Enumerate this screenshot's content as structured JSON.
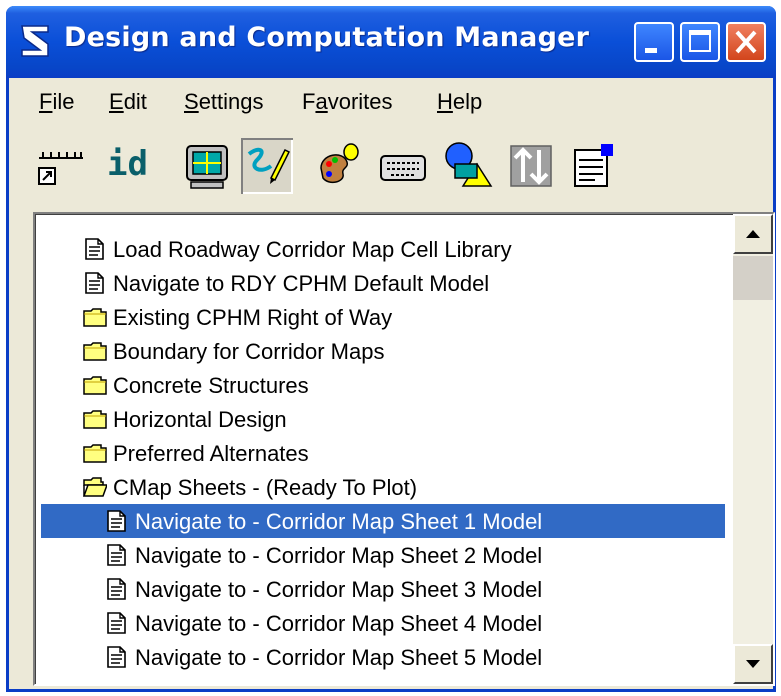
{
  "window": {
    "title": "Design and Computation Manager"
  },
  "menu": {
    "items": [
      {
        "pre": "",
        "u": "F",
        "post": "ile"
      },
      {
        "pre": "",
        "u": "E",
        "post": "dit"
      },
      {
        "pre": "",
        "u": "S",
        "post": "ettings"
      },
      {
        "pre": "F",
        "u": "a",
        "post": "vorites"
      },
      {
        "pre": "",
        "u": "H",
        "post": "elp"
      }
    ]
  },
  "toolbar": {
    "id_label": "id",
    "tools": [
      "scale-shortcut-icon",
      "id-icon",
      "display-icon",
      "draw-icon",
      "palette-icon",
      "keyboard-icon",
      "shapes-icon",
      "levels-icon",
      "properties-icon"
    ]
  },
  "list": {
    "items": [
      {
        "label": "Load Roadway Corridor Map Cell Library",
        "type": "doc"
      },
      {
        "label": "Navigate to RDY CPHM Default Model",
        "type": "doc"
      },
      {
        "label": "Existing CPHM Right of Way",
        "type": "folder"
      },
      {
        "label": "Boundary for Corridor Maps",
        "type": "folder"
      },
      {
        "label": "Concrete Structures",
        "type": "folder"
      },
      {
        "label": "Horizontal Design",
        "type": "folder"
      },
      {
        "label": "Preferred Alternates",
        "type": "folder"
      },
      {
        "label": "CMap Sheets - (Ready To Plot)",
        "type": "folder-open"
      },
      {
        "label": "Navigate to - Corridor Map Sheet 1 Model",
        "type": "doc",
        "selected": true
      },
      {
        "label": "Navigate to - Corridor Map Sheet 2 Model",
        "type": "doc"
      },
      {
        "label": "Navigate to - Corridor Map Sheet 3 Model",
        "type": "doc"
      },
      {
        "label": "Navigate to - Corridor Map Sheet 4 Model",
        "type": "doc"
      },
      {
        "label": "Navigate to - Corridor Map Sheet 5 Model",
        "type": "doc"
      }
    ]
  },
  "colors": {
    "titlebar": "#0a4fd8",
    "selection": "#316ac5",
    "chrome": "#ece9d8"
  }
}
